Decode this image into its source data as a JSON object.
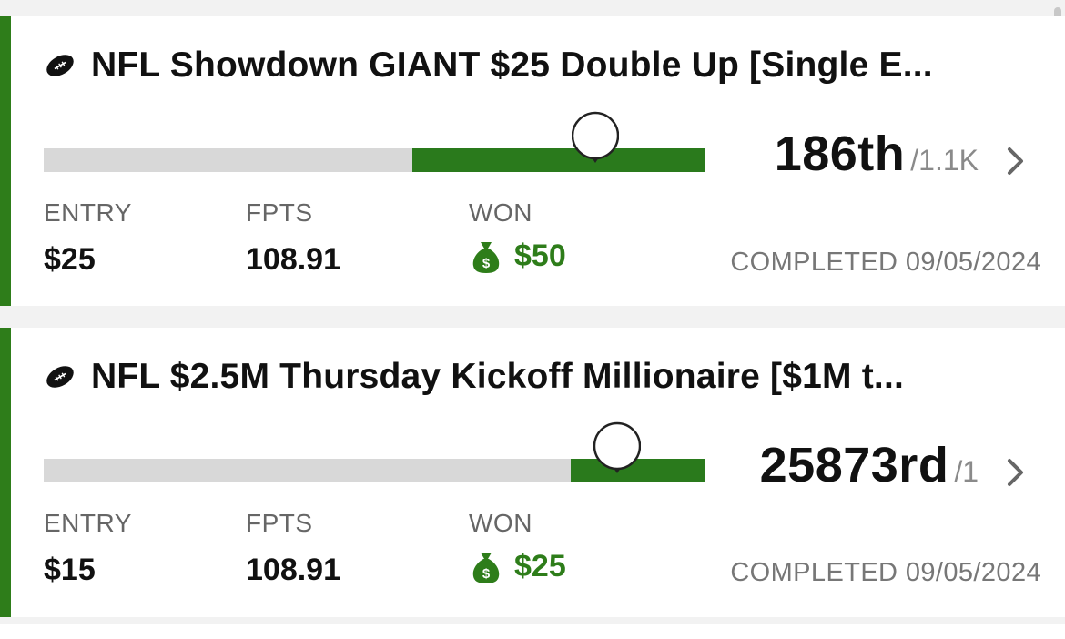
{
  "colors": {
    "accent": "#2e7d1a",
    "track": "#d8d8d8",
    "fill": "#2a7a1c"
  },
  "contests": [
    {
      "title": "NFL Showdown GIANT $25 Double Up [Single E...",
      "sport_icon": "football-icon",
      "progress_fill": 0.442,
      "marker_position": 0.835,
      "rank": "186th",
      "field_size": "/1.1K",
      "entry_label": "ENTRY",
      "entry_value": "$25",
      "fpts_label": "FPTS",
      "fpts_value": "108.91",
      "won_label": "WON",
      "won_value": "$50",
      "completed": "COMPLETED 09/05/2024"
    },
    {
      "title": "NFL $2.5M Thursday Kickoff Millionaire [$1M t...",
      "sport_icon": "football-icon",
      "progress_fill": 0.202,
      "marker_position": 0.868,
      "rank": "25873rd",
      "field_size": "/1",
      "entry_label": "ENTRY",
      "entry_value": "$15",
      "fpts_label": "FPTS",
      "fpts_value": "108.91",
      "won_label": "WON",
      "won_value": "$25",
      "completed": "COMPLETED 09/05/2024"
    }
  ]
}
